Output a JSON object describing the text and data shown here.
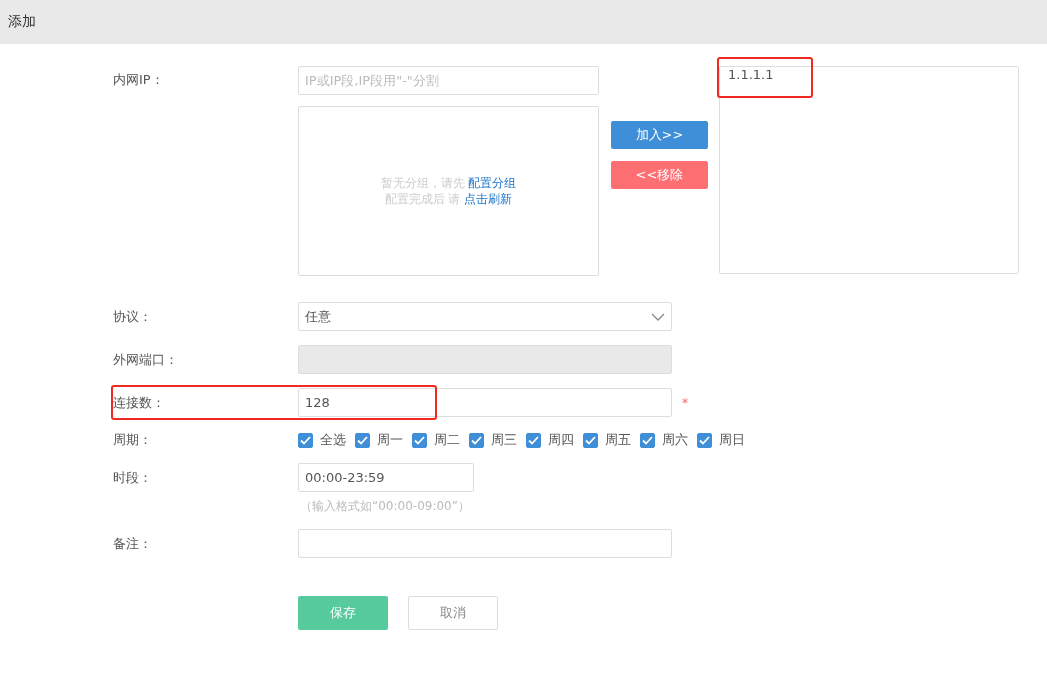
{
  "dialog": {
    "title": "添加"
  },
  "internal_ip": {
    "label": "内网IP：",
    "placeholder": "IP或IP段,IP段用\"-\"分割",
    "group_notice": {
      "line1": "暂无分组，请先",
      "link1": "配置分组",
      "line2": "配置完成后 请",
      "link2": "点击刷新"
    },
    "add_button": "加入>>",
    "remove_button": "<<移除",
    "selected_ips": [
      {
        "text": "1.1.1.1",
        "highlighted": true
      }
    ]
  },
  "protocol": {
    "label": "协议：",
    "value": "任意"
  },
  "external_port": {
    "label": "外网端口：",
    "disabled": true
  },
  "connections": {
    "label": "连接数：",
    "value": "128",
    "required_mark": "*",
    "highlighted": true
  },
  "period": {
    "label": "周期：",
    "options": [
      {
        "label": "全选",
        "checked": true
      },
      {
        "label": "周一",
        "checked": true
      },
      {
        "label": "周二",
        "checked": true
      },
      {
        "label": "周三",
        "checked": true
      },
      {
        "label": "周四",
        "checked": true
      },
      {
        "label": "周五",
        "checked": true
      },
      {
        "label": "周六",
        "checked": true
      },
      {
        "label": "周日",
        "checked": true
      }
    ]
  },
  "time_range": {
    "label": "时段：",
    "value": "00:00-23:59",
    "hint": "（输入格式如“00:00-09:00”）"
  },
  "remark": {
    "label": "备注："
  },
  "buttons": [
    {
      "label": "保存",
      "kind": "primary"
    },
    {
      "label": "取消",
      "kind": "secondary"
    }
  ]
}
